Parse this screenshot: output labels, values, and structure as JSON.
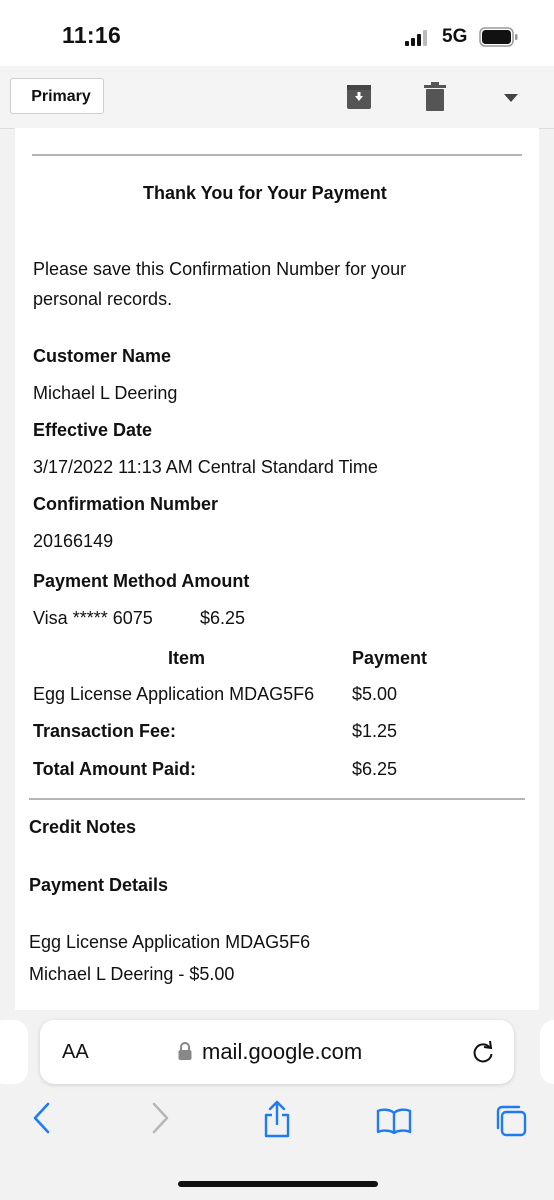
{
  "status": {
    "time": "11:16",
    "network": "5G"
  },
  "toolbar": {
    "primary_label": "Primary"
  },
  "email": {
    "heading": "Thank You for Your Payment",
    "intro_line1": "Please save this Confirmation Number for your",
    "intro_line2": "personal records.",
    "customer_name_label": "Customer Name",
    "customer_name": "Michael L Deering",
    "effective_date_label": "Effective Date",
    "effective_date": "3/17/2022 11:13 AM Central Standard Time",
    "confirmation_label": "Confirmation Number",
    "confirmation_number": "20166149",
    "payment_method_label": "Payment Method Amount",
    "payment_method": "Visa ***** 6075",
    "payment_amount": "$6.25",
    "table": {
      "col_item": "Item",
      "col_payment": "Payment",
      "row_item": "Egg License Application MDAG5F6",
      "row_amount": "$5.00",
      "fee_label": "Transaction Fee:",
      "fee_amount": "$1.25",
      "total_label": "Total Amount Paid:",
      "total_amount": "$6.25"
    },
    "credit_notes_label": "Credit Notes",
    "payment_details_label": "Payment Details",
    "details_line1": "Egg License Application MDAG5F6",
    "details_line2": "Michael L Deering - $5.00"
  },
  "browser": {
    "aa_label": "AA",
    "url": "mail.google.com"
  }
}
